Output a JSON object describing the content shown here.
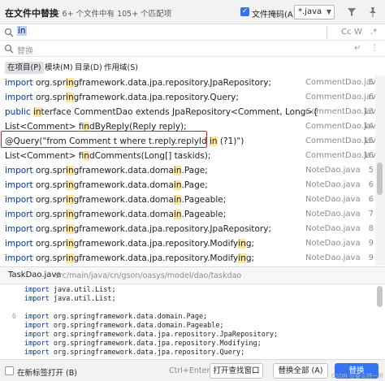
{
  "header": {
    "title": "在文件中替换",
    "subtitle": "在 6+ 个文件中有 105+ 个匹配项",
    "file_mask_label": "文件掩码(A):",
    "file_mask_value": "*.java"
  },
  "search": {
    "value": "in"
  },
  "search_options": {
    "case": "Cc",
    "words": "W",
    "regex": ".*"
  },
  "replace": {
    "placeholder": "替换",
    "opt1": "↵",
    "opt2": "⋮"
  },
  "scope_tabs": [
    "在项目(P)",
    "模块(M)",
    "目录(D)",
    "作用域(S)"
  ],
  "results": [
    {
      "pre": "import org.springframework.data.jpa.repository.JpaRepository;",
      "kw": "import ",
      "file": "CommentDao.java",
      "line": "5"
    },
    {
      "pre": "import org.springframework.data.jpa.repository.Query;",
      "kw": "import ",
      "file": "CommentDao.java",
      "line": "6"
    },
    {
      "pre": "public interface CommentDao extends JpaRepository<Comment, Long>{",
      "kw": "public ",
      "file": "CommentDao.java",
      "line": "13"
    },
    {
      "pre": "List<Comment> findByReply(Reply reply);",
      "kw": "",
      "file": "CommentDao.java",
      "line": "14"
    },
    {
      "pre": "@Query(\"from Comment t where t.reply.replyId in (?1)\")",
      "kw": "",
      "file": "CommentDao.java",
      "line": "15"
    },
    {
      "pre": "List<Comment> findComments(Long[] taskids);",
      "kw": "",
      "file": "CommentDao.java",
      "line": "16"
    },
    {
      "pre": "import org.springframework.data.domain.Page;",
      "kw": "import ",
      "file": "NoteDao.java",
      "line": "5"
    },
    {
      "pre": "import org.springframework.data.domain.Page;",
      "kw": "import ",
      "file": "NoteDao.java",
      "line": "6"
    },
    {
      "pre": "import org.springframework.data.domain.Pageable;",
      "kw": "import ",
      "file": "NoteDao.java",
      "line": "6"
    },
    {
      "pre": "import org.springframework.data.domain.Pageable;",
      "kw": "import ",
      "file": "NoteDao.java",
      "line": "7"
    },
    {
      "pre": "import org.springframework.data.jpa.repository.JpaRepository;",
      "kw": "import ",
      "file": "NoteDao.java",
      "line": "8"
    },
    {
      "pre": "import org.springframework.data.jpa.repository.Modifying;",
      "kw": "import ",
      "file": "NoteDao.java",
      "line": "9"
    },
    {
      "pre": "import org.springframework.data.jpa.repository.Modifying;",
      "kw": "import ",
      "file": "NoteDao.java",
      "line": "9"
    }
  ],
  "preview": {
    "file": "TaskDao.java",
    "path": "src/main/java/cn/gson/oasys/model/dao/taskdao",
    "lines": [
      {
        "n": "",
        "pre": "import java.util.List;"
      },
      {
        "n": "",
        "pre": "import java.util.List;"
      },
      {
        "n": "",
        "pre": ""
      },
      {
        "n": "6",
        "pre": "import org.springframework.data.domain.Page;"
      },
      {
        "n": "",
        "pre": "import org.springframework.data.domain.Pageable;"
      },
      {
        "n": "",
        "pre": "import org.springframework.data.jpa.repository.JpaRepository;"
      },
      {
        "n": "",
        "pre": "import org.springframework.data.jpa.repository.Modifying;"
      },
      {
        "n": "",
        "pre": "import org.springframework.data.jpa.repository.Query;"
      }
    ]
  },
  "footer": {
    "new_tab_label": "在新标签打开 (B)",
    "shortcut": "Ctrl+Enter",
    "open_find_window": "打开查找窗口",
    "replace_all": "替换全部 (A)",
    "replace": "替换",
    "watermark": "CSDN @要么拼一拼"
  },
  "colors": {
    "accent": "#3574f0",
    "highlight": "#ffe69e",
    "keyword": "#0033b3",
    "string": "#067d17",
    "annotation_box": "#e02020"
  }
}
